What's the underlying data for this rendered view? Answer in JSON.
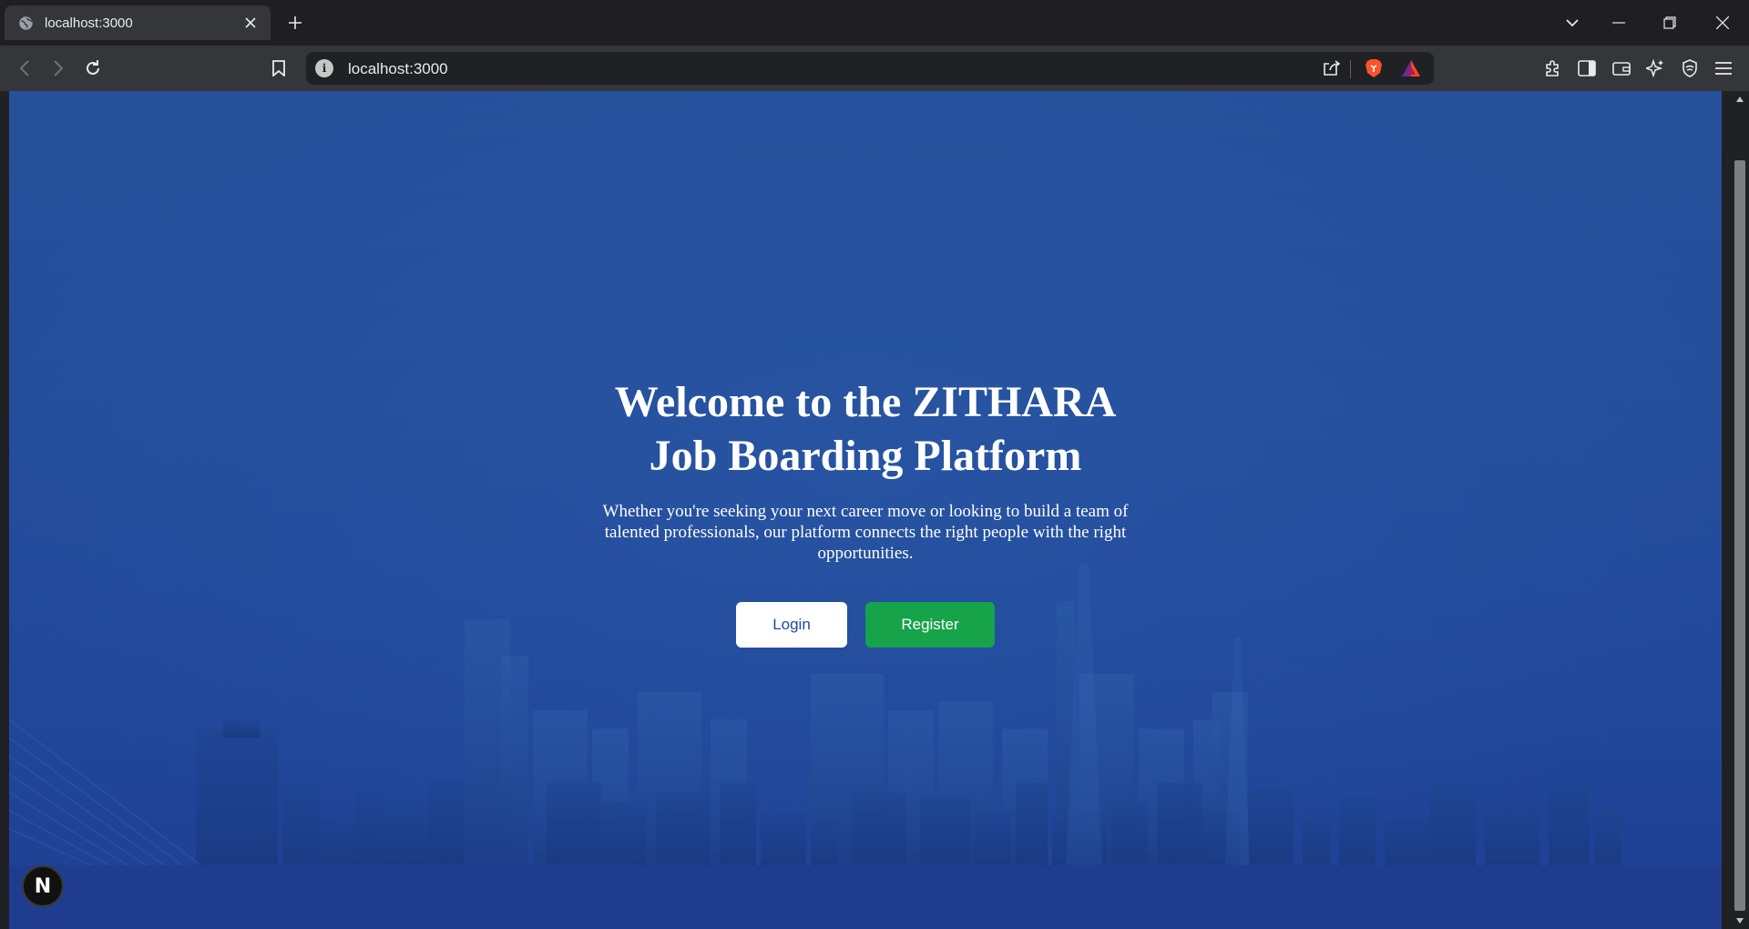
{
  "browser": {
    "tab": {
      "title": "localhost:3000",
      "favicon": "globe-icon"
    },
    "new_tab_icon": "plus-icon",
    "window_controls": [
      "tab-search-icon",
      "minimize-icon",
      "restore-icon",
      "close-icon"
    ],
    "toolbar": {
      "back_icon": "back-arrow-icon",
      "forward_icon": "forward-arrow-icon",
      "reload_icon": "reload-icon",
      "bookmark_icon": "bookmark-icon",
      "url": "localhost:3000",
      "info_icon": "site-info-icon",
      "right_icons": [
        "share-icon",
        "brave-shields-icon",
        "brave-rewards-icon"
      ],
      "extension_icons": [
        "extensions-icon",
        "sidebar-icon",
        "wallet-icon",
        "leo-ai-icon",
        "vpn-icon",
        "menu-icon"
      ]
    }
  },
  "hero": {
    "title_line1": "Welcome to the ZITHARA",
    "title_line2": "Job Boarding Platform",
    "description": "Whether you're seeking your next career move or looking to build a team of talented professionals, our platform connects the right people with the right opportunities.",
    "login_label": "Login",
    "register_label": "Register"
  },
  "dev_badge": {
    "label": "N",
    "icon": "nextjs-icon"
  },
  "colors": {
    "page_background": "#24509a",
    "login_text": "#1f4aa0",
    "register_button": "#16a34a",
    "chrome_dark": "#1f1f23",
    "chrome_toolbar": "#35363a"
  }
}
